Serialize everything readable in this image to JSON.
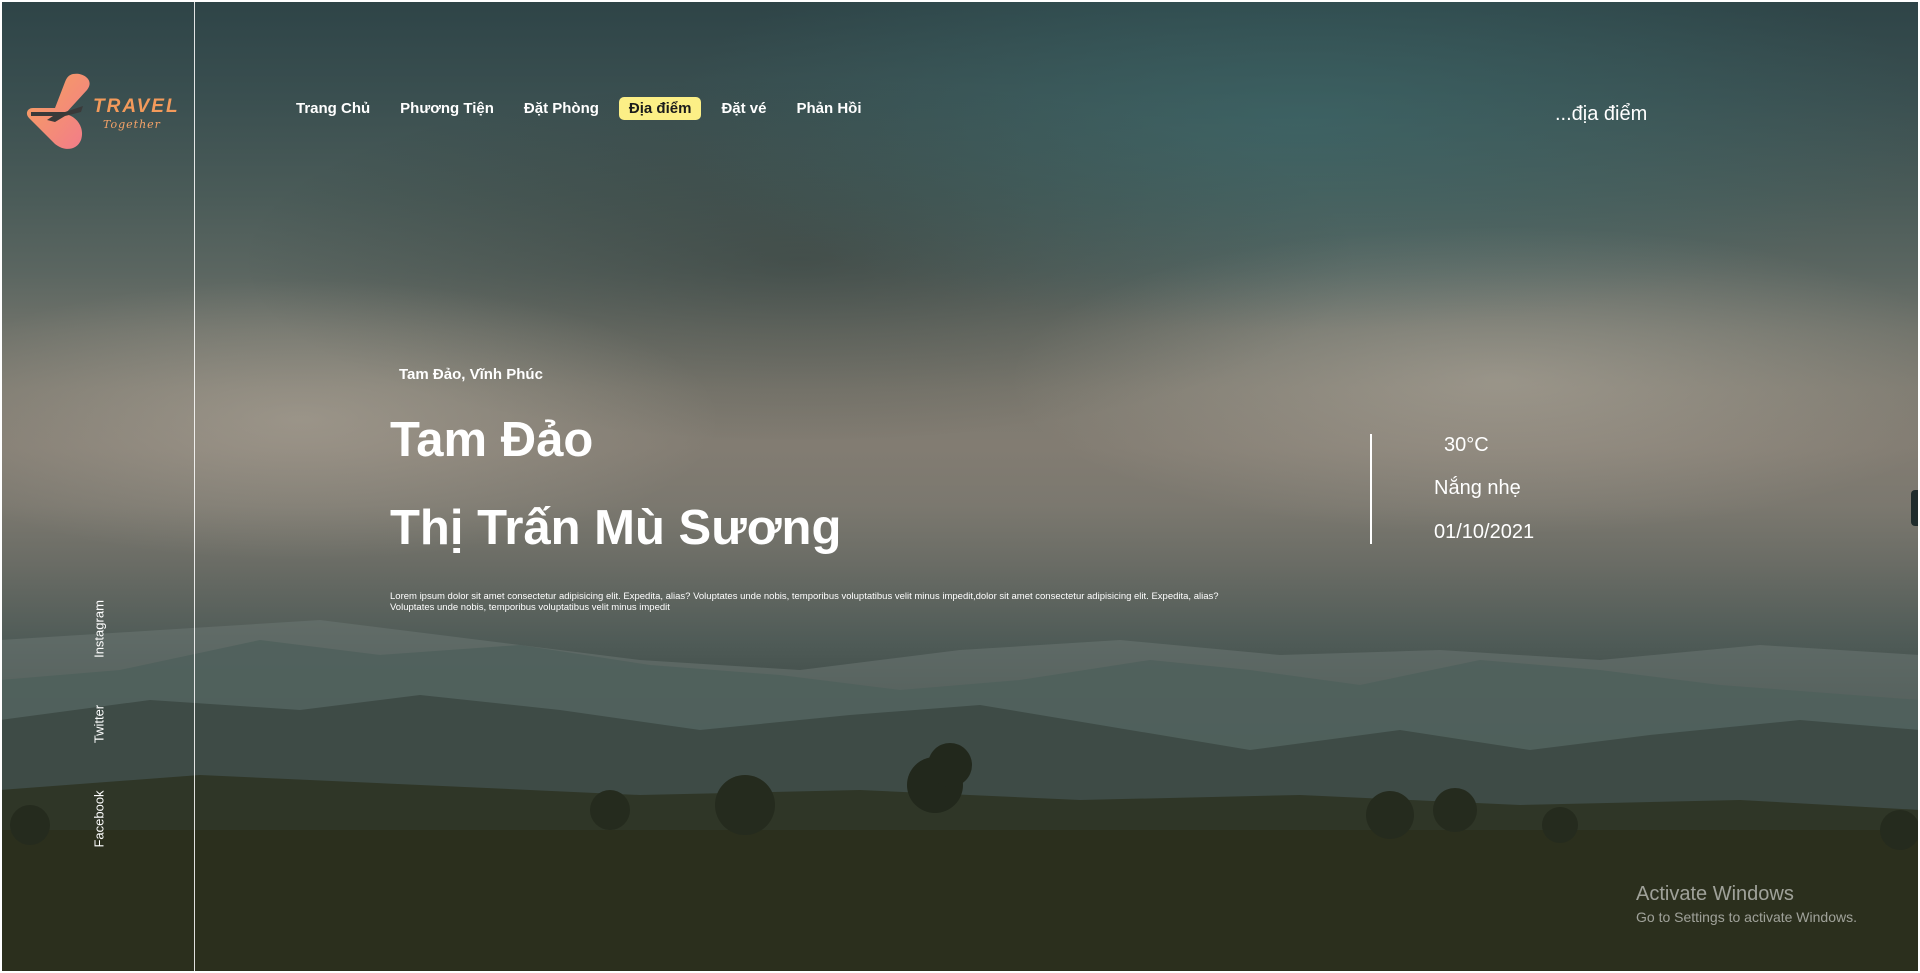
{
  "brand": {
    "name": "TRAVEL",
    "tagline": "Together"
  },
  "nav": {
    "items": [
      {
        "label": "Trang Chủ",
        "active": false
      },
      {
        "label": "Phương Tiện",
        "active": false
      },
      {
        "label": "Đặt Phòng",
        "active": false
      },
      {
        "label": "Địa điểm",
        "active": true
      },
      {
        "label": "Đặt vé",
        "active": false
      },
      {
        "label": "Phản Hồi",
        "active": false
      }
    ]
  },
  "search": {
    "text": "...địa điểm"
  },
  "hero": {
    "location": "Tam Đảo, Vĩnh Phúc",
    "title_line1": "Tam Đảo",
    "title_line2": "Thị Trấn Mù Sương",
    "description": "Lorem ipsum dolor sit amet consectetur adipisicing elit. Expedita, alias? Voluptates unde nobis, temporibus voluptatibus velit minus impedit,dolor sit amet consectetur adipisicing elit. Expedita, alias? Voluptates unde nobis, temporibus voluptatibus velit minus impedit"
  },
  "weather": {
    "temperature": "30°C",
    "condition": "Nắng nhẹ",
    "date": "01/10/2021"
  },
  "social": {
    "instagram": "Instagram",
    "twitter": "Twitter",
    "facebook": "Facebook"
  },
  "watermark": {
    "title": "Activate Windows",
    "subtitle": "Go to Settings to activate Windows."
  },
  "colors": {
    "nav_active_bg": "#fcef86",
    "logo_orange": "#f39a5b",
    "logo_pink": "#f47a8a",
    "text": "#ffffff"
  }
}
